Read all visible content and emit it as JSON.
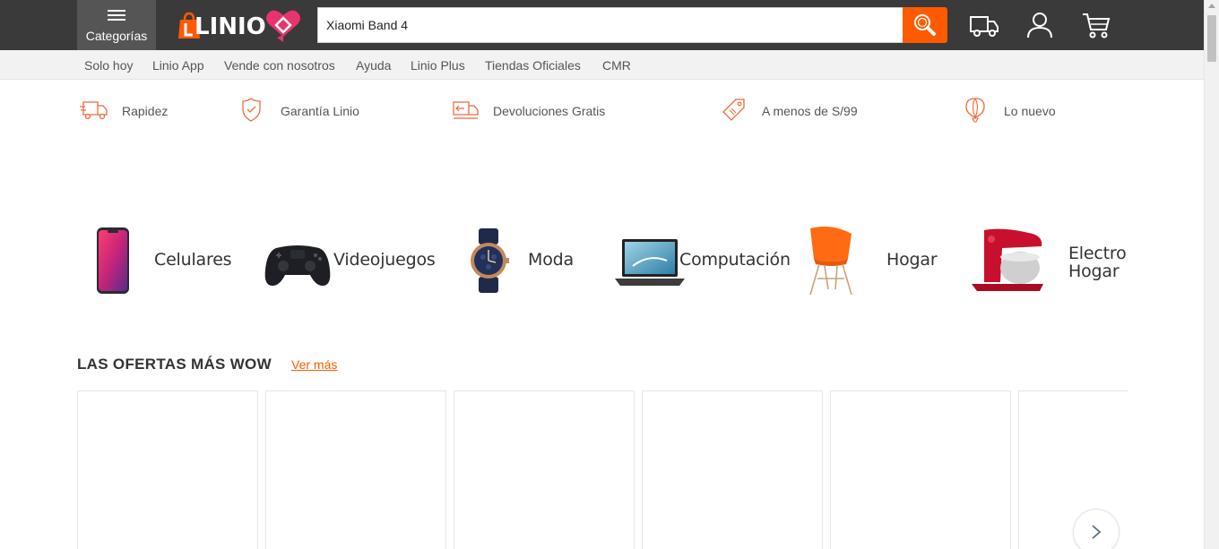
{
  "header": {
    "categories_label": "Categorías",
    "logo_text": "LINIO",
    "search": {
      "value": "Xiaomi Band 4",
      "placeholder": ""
    },
    "icons": [
      "delivery-truck-icon",
      "user-icon",
      "cart-icon"
    ]
  },
  "subnav": {
    "links": [
      "Solo hoy",
      "Linio App",
      "Vende con nosotros",
      "Ayuda",
      "Linio Plus",
      "Tiendas Oficiales",
      "CMR"
    ]
  },
  "benefits": [
    {
      "label": "Rapidez",
      "icon": "fast-truck-icon"
    },
    {
      "label": "Garantía Linio",
      "icon": "shield-check-icon"
    },
    {
      "label": "Devoluciones Gratis",
      "icon": "return-truck-icon"
    },
    {
      "label": "A menos de S/99",
      "icon": "price-tag-icon"
    },
    {
      "label": "Lo nuevo",
      "icon": "balloon-icon"
    }
  ],
  "categories": [
    {
      "label": "Celulares",
      "icon": "smartphone-image"
    },
    {
      "label": "Videojuegos",
      "icon": "gamepad-image"
    },
    {
      "label": "Moda",
      "icon": "watch-image"
    },
    {
      "label": "Computación",
      "icon": "laptop-image"
    },
    {
      "label": "Hogar",
      "icon": "chair-image"
    },
    {
      "label_line1": "Electro",
      "label_line2": "Hogar",
      "icon": "stand-mixer-image"
    }
  ],
  "offers": {
    "title": "LAS OFERTAS MÁS WOW",
    "see_more": "Ver más"
  },
  "colors": {
    "brand_orange": "#ff5a00",
    "brand_pink": "#e8336d",
    "header_bg": "#3a3a3a"
  }
}
